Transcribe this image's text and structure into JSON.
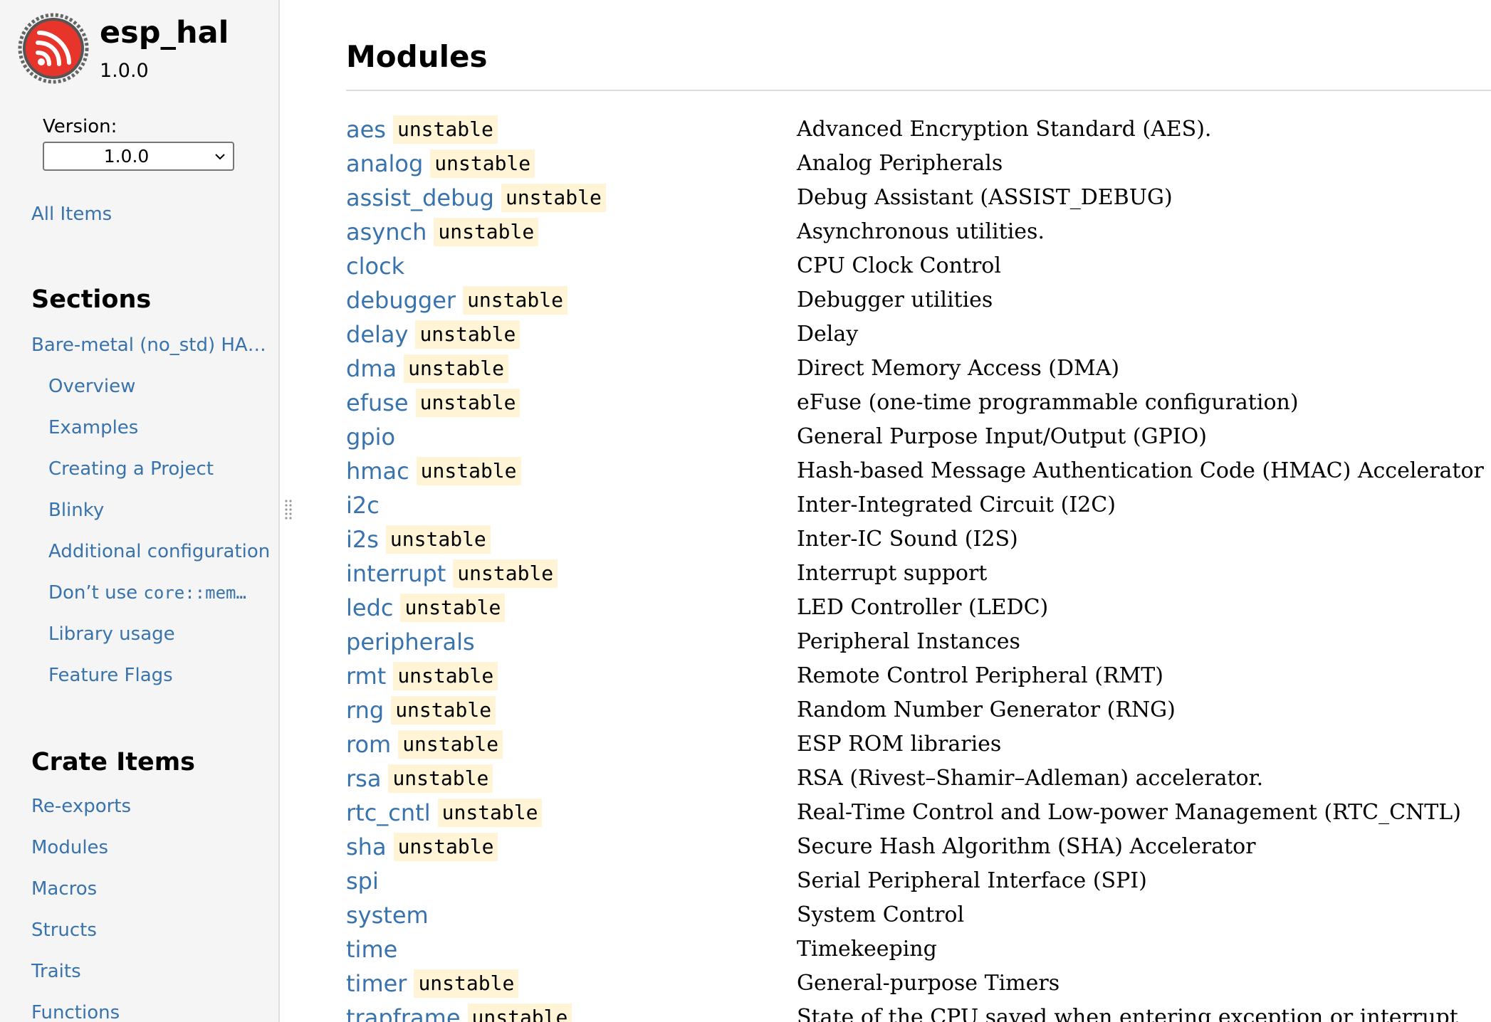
{
  "sidebar": {
    "crate_name": "esp_hal",
    "crate_version": "1.0.0",
    "version_label": "Version:",
    "version_selected": "1.0.0",
    "all_items": "All Items",
    "sections_heading": "Sections",
    "sections": {
      "top": "Bare-metal (no_std) HA…",
      "overview": "Overview",
      "examples": "Examples",
      "creating_project": "Creating a Project",
      "blinky": "Blinky",
      "additional_config": "Additional configuration",
      "dont_use_prefix": "Don’t use ",
      "dont_use_code": "core::mem…",
      "library_usage": "Library usage",
      "feature_flags": "Feature Flags"
    },
    "crate_items_heading": "Crate Items",
    "crate_items": {
      "reexports": "Re-exports",
      "modules": "Modules",
      "macros": "Macros",
      "structs": "Structs",
      "traits": "Traits",
      "functions": "Functions"
    }
  },
  "main": {
    "title": "Modules",
    "badge_label": "unstable",
    "modules": [
      {
        "name": "aes",
        "desc": "Advanced Encryption Standard (AES).",
        "unstable": true
      },
      {
        "name": "analog",
        "desc": "Analog Peripherals",
        "unstable": true
      },
      {
        "name": "assist_debug",
        "desc": "Debug Assistant (ASSIST_DEBUG)",
        "unstable": true
      },
      {
        "name": "asynch",
        "desc": "Asynchronous utilities.",
        "unstable": true
      },
      {
        "name": "clock",
        "desc": "CPU Clock Control",
        "unstable": false
      },
      {
        "name": "debugger",
        "desc": "Debugger utilities",
        "unstable": true
      },
      {
        "name": "delay",
        "desc": "Delay",
        "unstable": true
      },
      {
        "name": "dma",
        "desc": "Direct Memory Access (DMA)",
        "unstable": true
      },
      {
        "name": "efuse",
        "desc": "eFuse (one-time programmable configuration)",
        "unstable": true
      },
      {
        "name": "gpio",
        "desc": "General Purpose Input/Output (GPIO)",
        "unstable": false
      },
      {
        "name": "hmac",
        "desc": "Hash-based Message Authentication Code (HMAC) Accelerator",
        "unstable": true
      },
      {
        "name": "i2c",
        "desc": "Inter-Integrated Circuit (I2C)",
        "unstable": false
      },
      {
        "name": "i2s",
        "desc": "Inter-IC Sound (I2S)",
        "unstable": true
      },
      {
        "name": "interrupt",
        "desc": "Interrupt support",
        "unstable": true
      },
      {
        "name": "ledc",
        "desc": "LED Controller (LEDC)",
        "unstable": true
      },
      {
        "name": "peripherals",
        "desc": "Peripheral Instances",
        "unstable": false
      },
      {
        "name": "rmt",
        "desc": "Remote Control Peripheral (RMT)",
        "unstable": true
      },
      {
        "name": "rng",
        "desc": "Random Number Generator (RNG)",
        "unstable": true
      },
      {
        "name": "rom",
        "desc": "ESP ROM libraries",
        "unstable": true
      },
      {
        "name": "rsa",
        "desc": "RSA (Rivest–Shamir–Adleman) accelerator.",
        "unstable": true
      },
      {
        "name": "rtc_cntl",
        "desc": "Real-Time Control and Low-power Management (RTC_CNTL)",
        "unstable": true
      },
      {
        "name": "sha",
        "desc": "Secure Hash Algorithm (SHA) Accelerator",
        "unstable": true
      },
      {
        "name": "spi",
        "desc": "Serial Peripheral Interface (SPI)",
        "unstable": false
      },
      {
        "name": "system",
        "desc": "System Control",
        "unstable": false
      },
      {
        "name": "time",
        "desc": "Timekeeping",
        "unstable": false
      },
      {
        "name": "timer",
        "desc": "General-purpose Timers",
        "unstable": true
      },
      {
        "name": "trapframe",
        "desc": "State of the CPU saved when entering exception or interrupt",
        "unstable": true
      }
    ]
  },
  "colors": {
    "link": "#3873ad",
    "badge_bg": "#fff5d6",
    "sidebar_bg": "#f5f5f5",
    "logo_red": "#e7352c"
  },
  "icons": {
    "logo": "espressif-logo-icon",
    "select_arrow": "chevron-down-icon",
    "resize_handle": "drag-handle-icon"
  }
}
